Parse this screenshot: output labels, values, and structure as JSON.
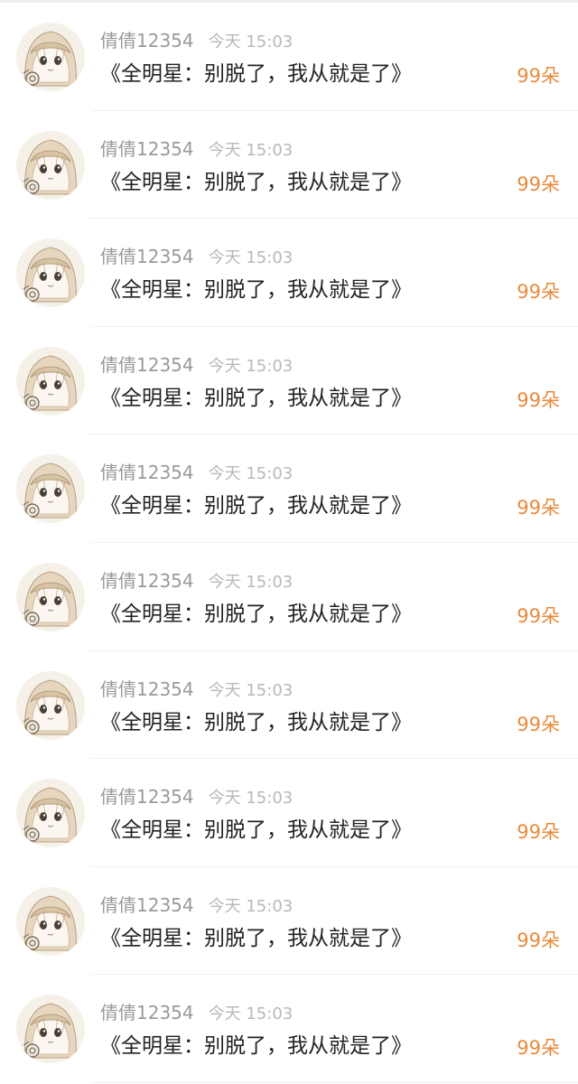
{
  "list": {
    "items": [
      {
        "user": "倩倩12354",
        "time": "今天 15:03",
        "message": "《全明星：别脱了，我从就是了》",
        "count": "99朵",
        "avatar_icon": "avatar-icon"
      },
      {
        "user": "倩倩12354",
        "time": "今天 15:03",
        "message": "《全明星：别脱了，我从就是了》",
        "count": "99朵",
        "avatar_icon": "avatar-icon"
      },
      {
        "user": "倩倩12354",
        "time": "今天 15:03",
        "message": "《全明星：别脱了，我从就是了》",
        "count": "99朵",
        "avatar_icon": "avatar-icon"
      },
      {
        "user": "倩倩12354",
        "time": "今天 15:03",
        "message": "《全明星：别脱了，我从就是了》",
        "count": "99朵",
        "avatar_icon": "avatar-icon"
      },
      {
        "user": "倩倩12354",
        "time": "今天 15:03",
        "message": "《全明星：别脱了，我从就是了》",
        "count": "99朵",
        "avatar_icon": "avatar-icon"
      },
      {
        "user": "倩倩12354",
        "time": "今天 15:03",
        "message": "《全明星：别脱了，我从就是了》",
        "count": "99朵",
        "avatar_icon": "avatar-icon"
      },
      {
        "user": "倩倩12354",
        "time": "今天 15:03",
        "message": "《全明星：别脱了，我从就是了》",
        "count": "99朵",
        "avatar_icon": "avatar-icon"
      },
      {
        "user": "倩倩12354",
        "time": "今天 15:03",
        "message": "《全明星：别脱了，我从就是了》",
        "count": "99朵",
        "avatar_icon": "avatar-icon"
      },
      {
        "user": "倩倩12354",
        "time": "今天 15:03",
        "message": "《全明星：别脱了，我从就是了》",
        "count": "99朵",
        "avatar_icon": "avatar-icon"
      },
      {
        "user": "倩倩12354",
        "time": "今天 15:03",
        "message": "《全明星：别脱了，我从就是了》",
        "count": "99朵",
        "avatar_icon": "avatar-icon"
      }
    ]
  },
  "colors": {
    "accent": "#e88a3a",
    "username": "#9a9a9a",
    "timestamp": "#b8b8b8",
    "message": "#222222"
  }
}
